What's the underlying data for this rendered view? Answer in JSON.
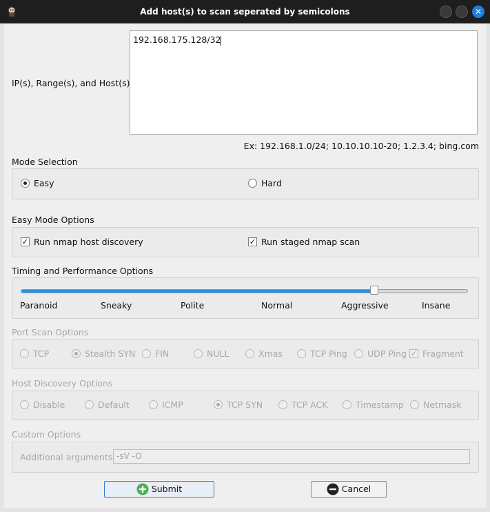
{
  "window": {
    "title": "Add host(s) to scan seperated by semicolons",
    "close_glyph": "✕"
  },
  "hosts": {
    "label": "IP(s), Range(s), and Host(s)",
    "value": "192.168.175.128/32",
    "example": "Ex: 192.168.1.0/24; 10.10.10.10-20; 1.2.3.4; bing.com"
  },
  "mode": {
    "heading": "Mode Selection",
    "options": [
      {
        "label": "Easy",
        "selected": true
      },
      {
        "label": "Hard",
        "selected": false
      }
    ]
  },
  "easy_options": {
    "heading": "Easy Mode Options",
    "items": [
      {
        "label": "Run nmap host discovery",
        "checked": true
      },
      {
        "label": "Run staged nmap scan",
        "checked": true
      }
    ]
  },
  "timing": {
    "heading": "Timing and Performance Options",
    "levels": [
      "Paranoid",
      "Sneaky",
      "Polite",
      "Normal",
      "Aggressive",
      "Insane"
    ],
    "selected": "Aggressive",
    "check_glyph": "✓"
  },
  "port_scan": {
    "heading": "Port Scan Options",
    "options": [
      {
        "label": "TCP",
        "selected": false
      },
      {
        "label": "Stealth SYN",
        "selected": true
      },
      {
        "label": "FIN",
        "selected": false
      },
      {
        "label": "NULL",
        "selected": false
      },
      {
        "label": "Xmas",
        "selected": false
      },
      {
        "label": "TCP Ping",
        "selected": false
      },
      {
        "label": "UDP Ping",
        "selected": false
      }
    ],
    "fragment": {
      "label": "Fragment",
      "checked": true
    }
  },
  "host_discovery": {
    "heading": "Host Discovery Options",
    "options": [
      {
        "label": "Disable",
        "selected": false
      },
      {
        "label": "Default",
        "selected": false
      },
      {
        "label": "ICMP",
        "selected": false
      },
      {
        "label": "TCP SYN",
        "selected": true
      },
      {
        "label": "TCP ACK",
        "selected": false
      },
      {
        "label": "Timestamp",
        "selected": false
      },
      {
        "label": "Netmask",
        "selected": false
      }
    ]
  },
  "custom": {
    "heading": "Custom Options",
    "label": "Additional arguments",
    "value": "-sV -O"
  },
  "buttons": {
    "submit": "Submit",
    "cancel": "Cancel"
  },
  "colors": {
    "accent": "#2b8fdc",
    "submit_icon": "#4caf50"
  }
}
